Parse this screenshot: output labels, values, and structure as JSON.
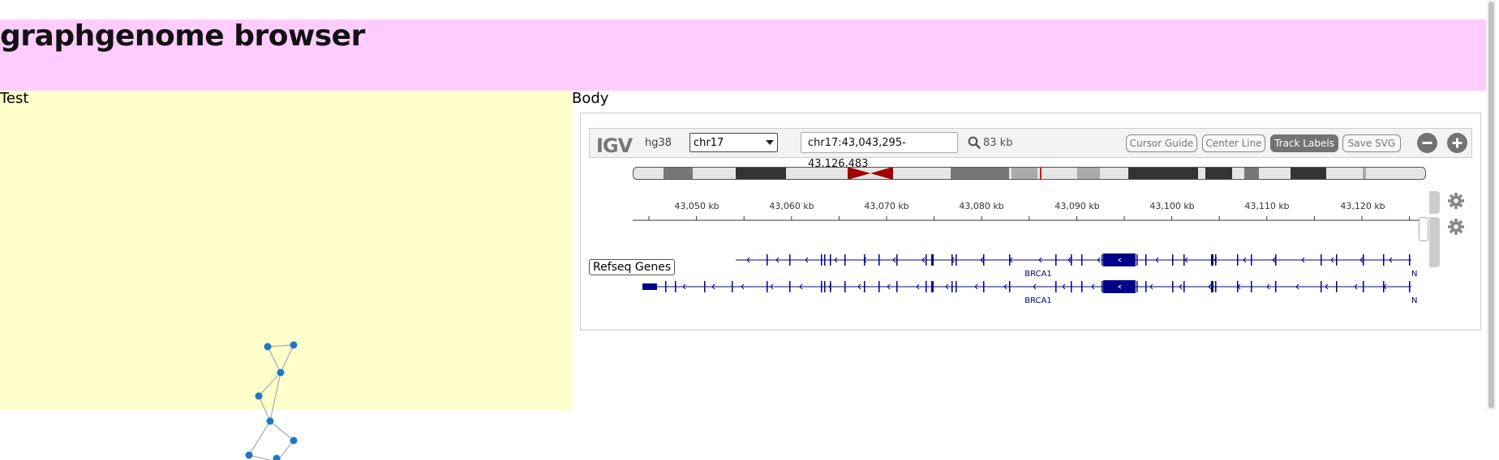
{
  "header": {
    "title": "graphgenome browser",
    "background": "#ffccff"
  },
  "left_panel": {
    "title": "Test",
    "background": "#ffffcc"
  },
  "right_panel": {
    "title": "Body"
  },
  "igv": {
    "logo": "IGV",
    "genome": "hg38",
    "chromosome": {
      "selected": "chr17"
    },
    "locus": "chr17:43,043,295-43,126,483",
    "window_size": "83 kb",
    "buttons": {
      "cursor_guide": "Cursor Guide",
      "center_line": "Center Line",
      "track_labels": "Track Labels",
      "save_svg": "Save SVG"
    },
    "active_button": "track_labels",
    "zoom_out_icon": "minus-circle-icon",
    "zoom_in_icon": "plus-circle-icon",
    "ruler_ticks": [
      "43,050 kb",
      "43,060 kb",
      "43,070 kb",
      "43,080 kb",
      "43,090 kb",
      "43,100 kb",
      "43,110 kb",
      "43,120 kb"
    ],
    "track": {
      "label": "Refseq Genes",
      "gene_labels": [
        "BRCA1",
        "BRCA1"
      ],
      "truncated_labels": [
        "N",
        "N"
      ],
      "gene_color": "#00008b"
    },
    "gear_icon": "gear-icon"
  }
}
